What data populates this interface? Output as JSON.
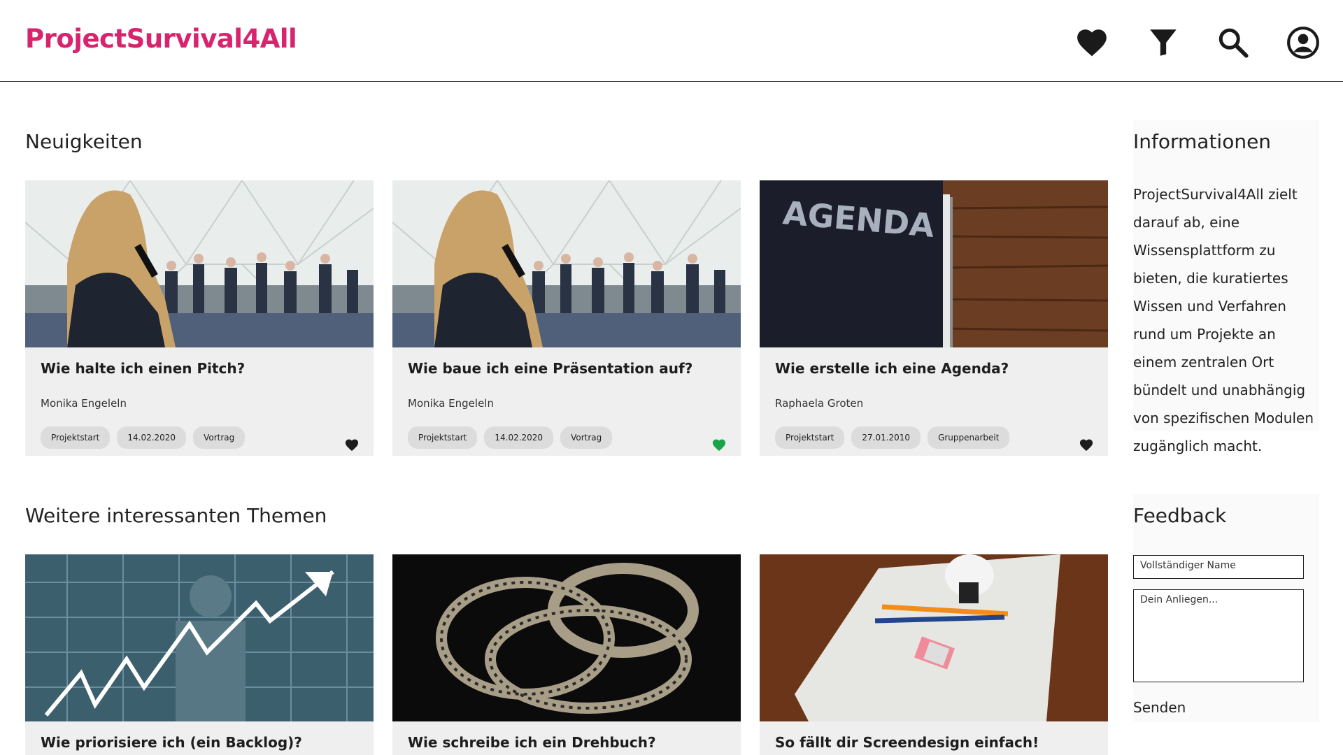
{
  "header": {
    "brand": "ProjectSurvival4All",
    "icons": [
      "heart-icon",
      "filter-icon",
      "search-icon",
      "account-icon"
    ]
  },
  "news": {
    "title": "Neuigkeiten",
    "cards": [
      {
        "title": "Wie halte ich einen Pitch?",
        "author": "Monika Engeleln",
        "tags": [
          "Projektstart",
          "14.02.2020",
          "Vortrag"
        ],
        "favorite": false,
        "image": "presentation-speaker-photo"
      },
      {
        "title": "Wie baue ich eine Präsentation auf?",
        "author": "Monika Engeleln",
        "tags": [
          "Projektstart",
          "14.02.2020",
          "Vortrag"
        ],
        "favorite": true,
        "image": "presentation-speaker-photo"
      },
      {
        "title": "Wie erstelle ich eine Agenda?",
        "author": "Raphaela Groten",
        "tags": [
          "Projektstart",
          "27.01.2010",
          "Gruppenarbeit"
        ],
        "favorite": false,
        "image": "agenda-book-photo",
        "image_text": "AGENDA"
      }
    ]
  },
  "more": {
    "title": "Weitere interessanten Themen",
    "cards": [
      {
        "title": "Wie priorisiere ich (ein Backlog)?",
        "image": "growth-chart-photo"
      },
      {
        "title": "Wie schreibe ich ein Drehbuch?",
        "image": "film-reel-photo"
      },
      {
        "title": "So fällt dir Screendesign einfach!",
        "image": "paper-pencils-photo"
      }
    ]
  },
  "info": {
    "title": "Informationen",
    "text": "ProjectSurvival4All zielt darauf ab, eine Wissensplattform zu bieten, die kuratiertes Wissen und Verfahren rund um Projekte an einem zentralen Ort bündelt und unabhängig von spezifischen Modulen zugänglich macht."
  },
  "feedback": {
    "title": "Feedback",
    "name_placeholder": "Vollständiger Name",
    "message_placeholder": "Dein Anliegen...",
    "send_label": "Senden"
  },
  "colors": {
    "brand": "#d6246e",
    "favorite_active": "#1aa347",
    "favorite_inactive": "#1d1d1d"
  }
}
